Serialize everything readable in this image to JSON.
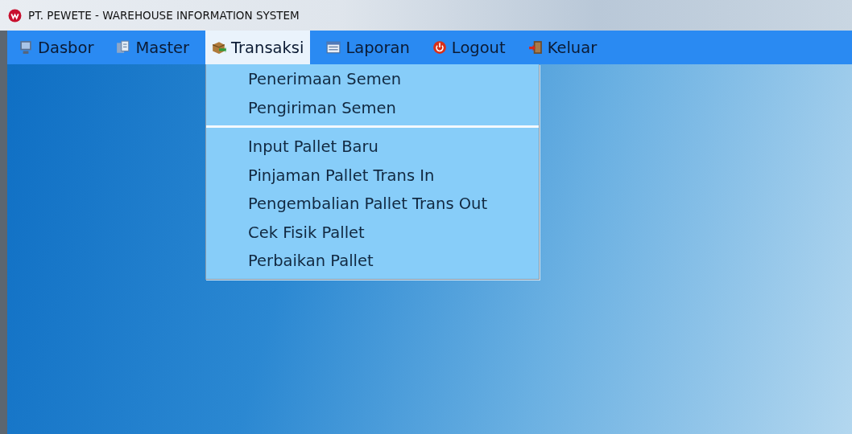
{
  "window": {
    "title": "PT. PEWETE - WAREHOUSE INFORMATION SYSTEM"
  },
  "menu_bar": [
    {
      "label": "Dasbor",
      "kind": "monitor",
      "selected": false
    },
    {
      "label": "Master",
      "kind": "document",
      "selected": false
    },
    {
      "label": "Transaksi",
      "kind": "box",
      "selected": true
    },
    {
      "label": "Laporan",
      "kind": "report",
      "selected": false
    },
    {
      "label": "Logout",
      "kind": "power",
      "selected": false
    },
    {
      "label": "Keluar",
      "kind": "exit",
      "selected": false
    }
  ],
  "dropdown": [
    {
      "kind": "item",
      "label": "Penerimaan Semen"
    },
    {
      "kind": "item",
      "label": "Pengiriman Semen"
    },
    {
      "kind": "separator"
    },
    {
      "kind": "item",
      "label": "Input Pallet Baru"
    },
    {
      "kind": "item",
      "label": "Pinjaman Pallet Trans In"
    },
    {
      "kind": "item",
      "label": "Pengembalian Pallet Trans Out"
    },
    {
      "kind": "item",
      "label": "Cek Fisik Pallet"
    },
    {
      "kind": "item",
      "label": "Perbaikan Pallet"
    }
  ]
}
